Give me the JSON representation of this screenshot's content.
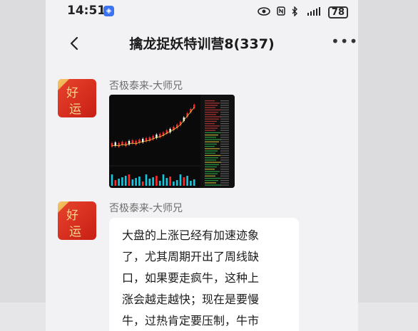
{
  "status_bar": {
    "time": "14:51",
    "app_badge": "◈",
    "battery": "78"
  },
  "header": {
    "title": "擒龙捉妖特训营8(337)"
  },
  "messages": [
    {
      "sender": "否极泰来-大师兄",
      "avatar_text_top": "好",
      "avatar_text_bottom": "运",
      "type": "image"
    },
    {
      "sender": "否极泰来-大师兄",
      "avatar_text_top": "好",
      "avatar_text_bottom": "运",
      "type": "text",
      "text": "大盘的上涨已经有加速迹象\n了，尤其周期开出了周线缺\n口，如果要走疯牛，这种上\n涨会越走越快；现在是要慢\n牛，过热肯定要压制，牛市"
    }
  ],
  "colors": {
    "background": "#f2f2f4",
    "bubble": "#ffffff",
    "avatar": "#d8291c",
    "candle_up": "#ff2b2b",
    "volume": "#18c8e0"
  }
}
